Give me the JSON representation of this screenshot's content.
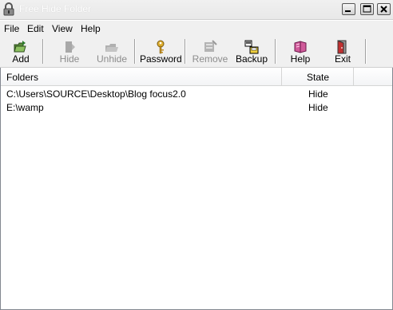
{
  "window": {
    "title": "Free Hide Folder",
    "colors": {
      "titlebar": "#ececec",
      "menubar": "#f0f0f0"
    }
  },
  "menu": {
    "items": [
      {
        "label": "File"
      },
      {
        "label": "Edit"
      },
      {
        "label": "View"
      },
      {
        "label": "Help"
      }
    ]
  },
  "toolbar": {
    "buttons": [
      {
        "label": "Add",
        "icon": "add-folder-icon",
        "enabled": true
      },
      {
        "label": "Hide",
        "icon": "hide-folder-icon",
        "enabled": false
      },
      {
        "label": "Unhide",
        "icon": "unhide-folder-icon",
        "enabled": false
      },
      {
        "label": "Password",
        "icon": "key-icon",
        "enabled": true
      },
      {
        "label": "Remove",
        "icon": "remove-icon",
        "enabled": false
      },
      {
        "label": "Backup",
        "icon": "backup-icon",
        "enabled": true
      },
      {
        "label": "Help",
        "icon": "help-book-icon",
        "enabled": true
      },
      {
        "label": "Exit",
        "icon": "exit-door-icon",
        "enabled": true
      }
    ]
  },
  "list": {
    "columns": [
      {
        "label": "Folders"
      },
      {
        "label": "State"
      }
    ],
    "rows": [
      {
        "folder": "C:\\Users\\SOURCE\\Desktop\\Blog focus2.0",
        "state": "Hide"
      },
      {
        "folder": "E:\\wamp",
        "state": "Hide"
      }
    ]
  }
}
